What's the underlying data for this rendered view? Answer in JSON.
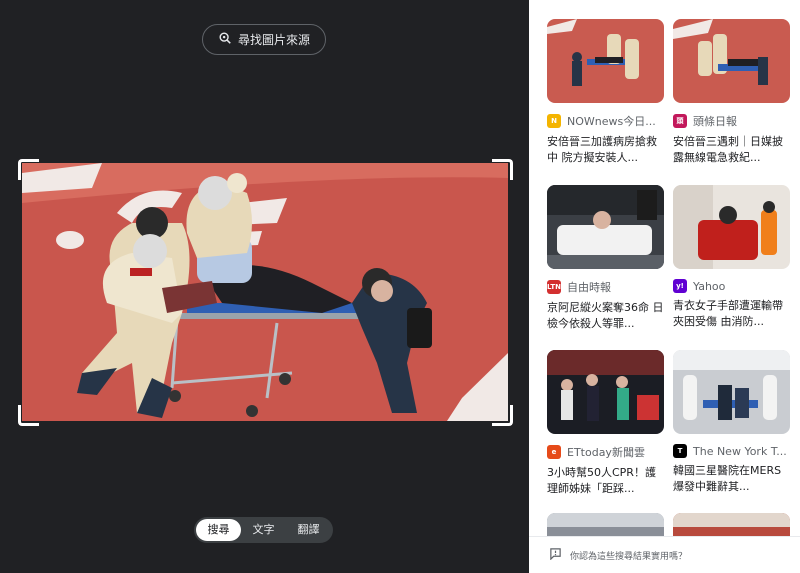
{
  "left_panel": {
    "find_source_label": "尋找圖片來源",
    "modes": [
      "搜尋",
      "文字",
      "翻譯"
    ],
    "active_mode": "搜尋"
  },
  "results": [
    {
      "source": "NOWnews今日...",
      "title": "安倍晉三加護病房搶救中 院方擬安裝人...",
      "favicon": "nownews-icon",
      "favicon_color": "#f4b400"
    },
    {
      "source": "頭條日報",
      "title": "安倍晉三遇刺｜日媒披露無線電急救紀...",
      "favicon": "headline-daily-icon",
      "favicon_color": "#c2185b"
    },
    {
      "source": "自由時報",
      "title": "京阿尼縱火案奪36命 日檢今依殺人等罪...",
      "favicon": "ltn-icon",
      "favicon_color": "#d32f2f"
    },
    {
      "source": "Yahoo",
      "title": "青衣女子手部遭運輸帶夾困受傷 由消防...",
      "favicon": "yahoo-icon",
      "favicon_color": "#6001d2"
    },
    {
      "source": "ETtoday新聞雲",
      "title": "3小時幫50人CPR！護理師姊妹「距踩...",
      "favicon": "ettoday-icon",
      "favicon_color": "#e64a19"
    },
    {
      "source": "The New York T...",
      "title": "韓國三星醫院在MERS爆發中難辭其...",
      "favicon": "nyt-icon",
      "favicon_color": "#000000"
    }
  ],
  "feedback": {
    "label": "你認為這些搜尋結果實用嗎？"
  }
}
